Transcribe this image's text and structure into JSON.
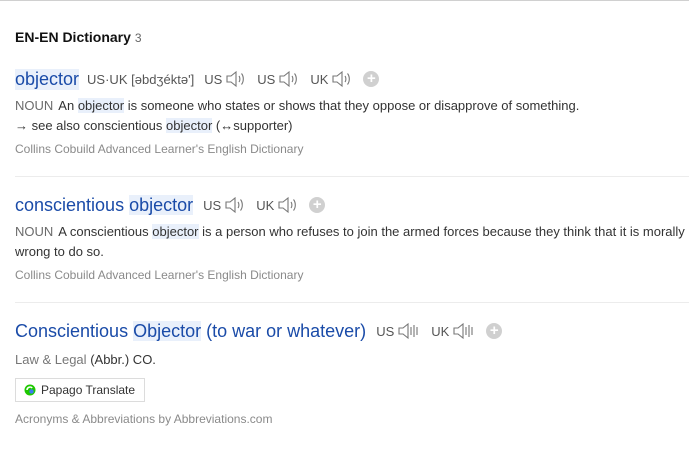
{
  "section": {
    "title": "EN-EN Dictionary",
    "count": "3"
  },
  "entries": [
    {
      "headword": "objector",
      "pron_label": "US·UK",
      "pron_text": "[əbdʒéktə']",
      "audio": [
        "US",
        "UK"
      ],
      "pos": "NOUN",
      "def_before": "An",
      "def_hl": "objector",
      "def_after": "is someone who states or shows that they oppose or disapprove of something.",
      "see_also_before": "→ see also conscientious",
      "see_also_hl": "objector",
      "see_also_after": "(↔supporter)",
      "source": "Collins Cobuild Advanced Learner's English Dictionary"
    },
    {
      "headword_plain": "conscientious",
      "headword_hl": "objector",
      "audio": [
        "US",
        "UK"
      ],
      "pos": "NOUN",
      "def_before": "A conscientious",
      "def_hl": "objector",
      "def_after": "is a person who refuses to join the armed forces because they think that it is morally wrong to do so.",
      "source": "Collins Cobuild Advanced Learner's English Dictionary"
    },
    {
      "headword_plain": "Conscientious",
      "headword_hl": "Objector",
      "headword_rest": "(to war or whatever)",
      "audio": [
        "US",
        "UK"
      ],
      "category": "Law & Legal",
      "abbr": "(Abbr.) CO.",
      "translate_button": "Papago Translate",
      "source": "Acronyms & Abbreviations by Abbreviations.com"
    }
  ],
  "icons": {
    "speaker": "speaker-icon",
    "speaker_bars": "speaker-bars-icon",
    "add": "plus-icon",
    "papago": "papago-logo-icon"
  },
  "colors": {
    "headword": "#1a4ba8",
    "highlight": "#e9f0fb",
    "papago_green": "#1ec800",
    "papago_blue": "#3d7cf0"
  }
}
